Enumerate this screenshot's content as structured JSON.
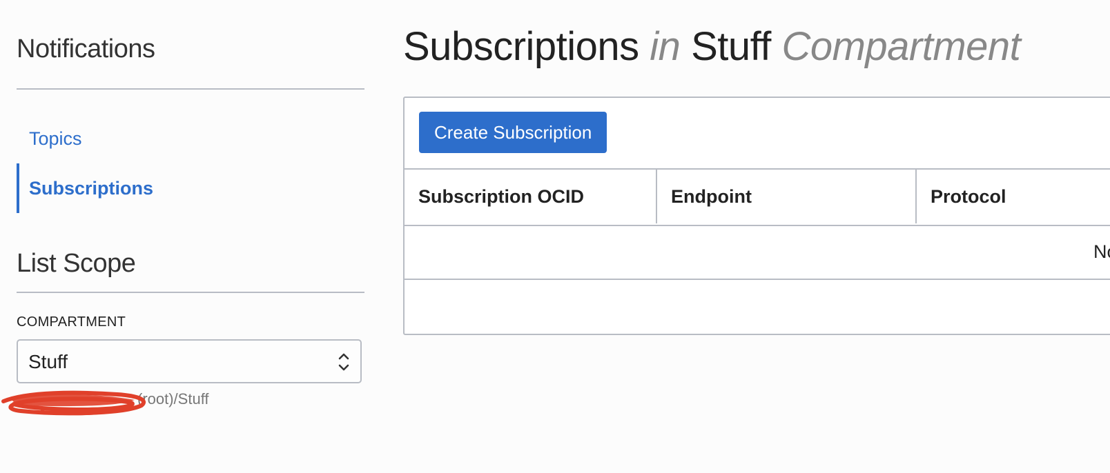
{
  "sidebar": {
    "title": "Notifications",
    "nav": [
      {
        "label": "Topics",
        "active": false
      },
      {
        "label": "Subscriptions",
        "active": true
      }
    ],
    "scope_title": "List Scope",
    "compartment_label": "COMPARTMENT",
    "compartment_value": "Stuff",
    "compartment_path": "(root)/Stuff"
  },
  "main": {
    "title_part1": "Subscriptions",
    "title_in": "in",
    "title_part2": "Stuff",
    "title_part3": "Compartment",
    "create_button": "Create Subscription",
    "columns": [
      "Subscription OCID",
      "Endpoint",
      "Protocol"
    ],
    "empty_text": "No"
  },
  "colors": {
    "accent": "#2d6ecb",
    "border": "#b8bcc4",
    "redaction": "#e0402a"
  }
}
